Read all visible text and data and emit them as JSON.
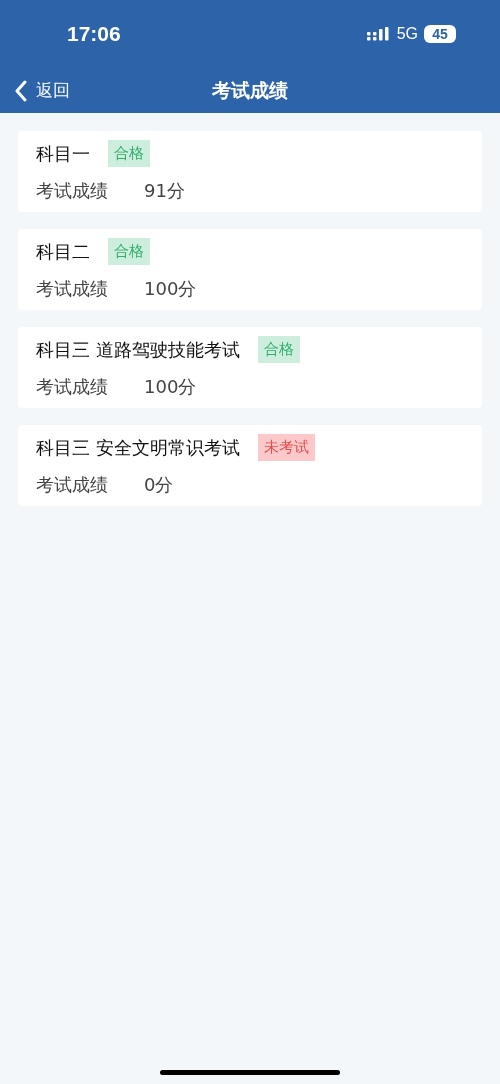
{
  "status_bar": {
    "time": "17:06",
    "network": "5G",
    "battery": "45"
  },
  "nav_bar": {
    "back": "返回",
    "title": "考试成绩"
  },
  "results": [
    {
      "subject": "科目一",
      "status": "合格",
      "kind": "passed",
      "label": "考试成绩",
      "score": "91分"
    },
    {
      "subject": "科目二",
      "status": "合格",
      "kind": "passed",
      "label": "考试成绩",
      "score": "100分"
    },
    {
      "subject": "科目三 道路驾驶技能考试",
      "status": "合格",
      "kind": "passed",
      "label": "考试成绩",
      "score": "100分"
    },
    {
      "subject": "科目三 安全文明常识考试",
      "status": "未考试",
      "kind": "not_taken",
      "label": "考试成绩",
      "score": "0分"
    }
  ]
}
